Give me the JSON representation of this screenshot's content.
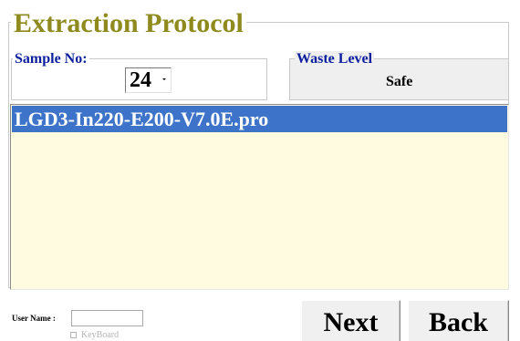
{
  "title": "Extraction Protocol",
  "sample": {
    "label": "Sample No:",
    "value": "24"
  },
  "waste": {
    "label": "Waste Level",
    "value": "Safe"
  },
  "protocols": [
    {
      "name": "LGD3-In220-E200-V7.0E.pro",
      "selected": true
    }
  ],
  "user": {
    "label": "User Name :",
    "value": "",
    "keyboard_label": "KeyBoard",
    "keyboard_checked": false
  },
  "buttons": {
    "next_label": "Next",
    "back_label": "Back"
  },
  "colors": {
    "title": "#8f8a1e",
    "legend": "#0b1f9e",
    "list_background": "#fffbe1",
    "selection": "#3d73c8"
  }
}
